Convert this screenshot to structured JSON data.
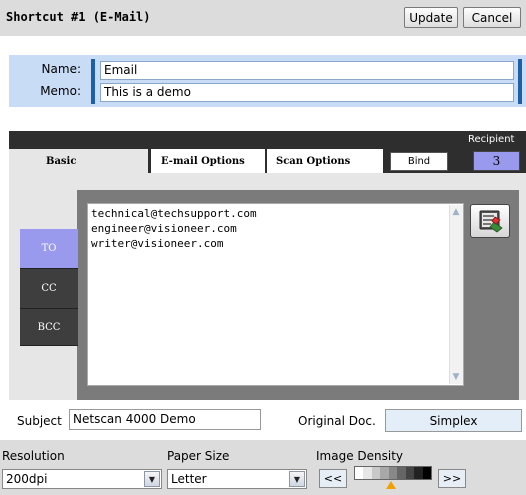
{
  "header": {
    "title": "Shortcut #1 (E-Mail)",
    "update_label": "Update",
    "cancel_label": "Cancel"
  },
  "profile": {
    "name_label": "Name:",
    "name_value": "Email",
    "memo_label": "Memo:",
    "memo_value": "This is a demo"
  },
  "tabs": [
    {
      "label": "Basic",
      "active": true
    },
    {
      "label": "E-mail Options",
      "active": false
    },
    {
      "label": "Scan Options",
      "active": false
    }
  ],
  "bind_label": "Bind",
  "recipient": {
    "label": "Recipient",
    "count": "3"
  },
  "recipient_types": [
    {
      "label": "TO",
      "selected": true
    },
    {
      "label": "CC",
      "selected": false
    },
    {
      "label": "BCC",
      "selected": false
    }
  ],
  "addresses": "technical@techsupport.com\nengineer@visioneer.com\nwriter@visioneer.com",
  "address_book_icon": "address-book-icon",
  "subject": {
    "label": "Subject",
    "value": "Netscan 4000 Demo"
  },
  "original_doc": {
    "label": "Original Doc.",
    "value": "Simplex"
  },
  "resolution": {
    "label": "Resolution",
    "value": "200dpi"
  },
  "paper_size": {
    "label": "Paper Size",
    "value": "Letter"
  },
  "image_density": {
    "label": "Image Density",
    "decrease_label": "<<",
    "increase_label": ">>",
    "level": 5,
    "levels": 9
  },
  "colors": {
    "selected_accent": "#9999ee",
    "panel_blue": "#c8dcf6",
    "dark_tab": "#2e2e2e"
  }
}
